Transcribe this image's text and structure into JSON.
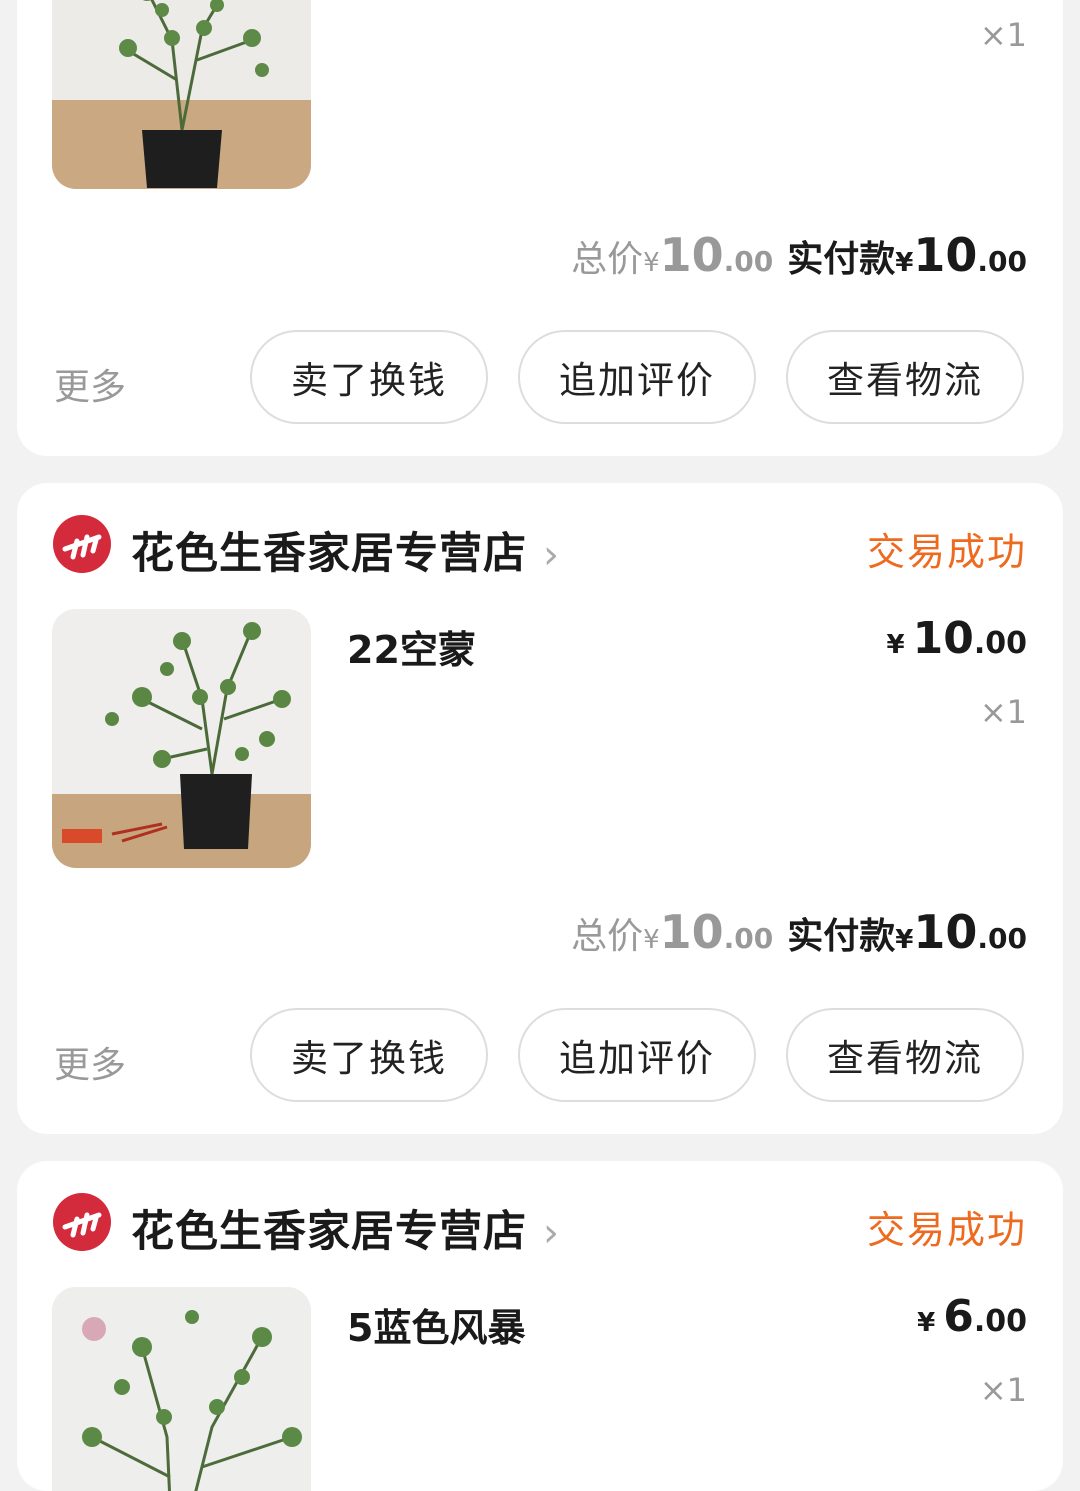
{
  "orders": [
    {
      "qty": "×1",
      "totals": {
        "total_label": "总价",
        "total_currency": "¥",
        "total_int": "10",
        "total_dec": ".00",
        "paid_label": "实付款",
        "paid_currency": "¥",
        "paid_int": "10",
        "paid_dec": ".00"
      },
      "more": "更多",
      "buttons": [
        "卖了换钱",
        "追加评价",
        "查看物流"
      ]
    },
    {
      "shop_name": "花色生香家居专营店",
      "chevron": "›",
      "status": "交易成功",
      "product_name": "22空蒙",
      "price": {
        "currency": "¥",
        "int": "10",
        "dec": ".00"
      },
      "qty": "×1",
      "totals": {
        "total_label": "总价",
        "total_currency": "¥",
        "total_int": "10",
        "total_dec": ".00",
        "paid_label": "实付款",
        "paid_currency": "¥",
        "paid_int": "10",
        "paid_dec": ".00"
      },
      "more": "更多",
      "buttons": [
        "卖了换钱",
        "追加评价",
        "查看物流"
      ]
    },
    {
      "shop_name": "花色生香家居专营店",
      "chevron": "›",
      "status": "交易成功",
      "product_name": "5蓝色风暴",
      "price": {
        "currency": "¥",
        "int": "6",
        "dec": ".00"
      },
      "qty": "×1"
    }
  ],
  "colors": {
    "status": "#ee6a1f",
    "logo": "#d32a3c",
    "background": "#f2f2f2"
  },
  "icons": {
    "shop_logo": "shop-logo-icon",
    "chevron": "chevron-right-icon"
  }
}
